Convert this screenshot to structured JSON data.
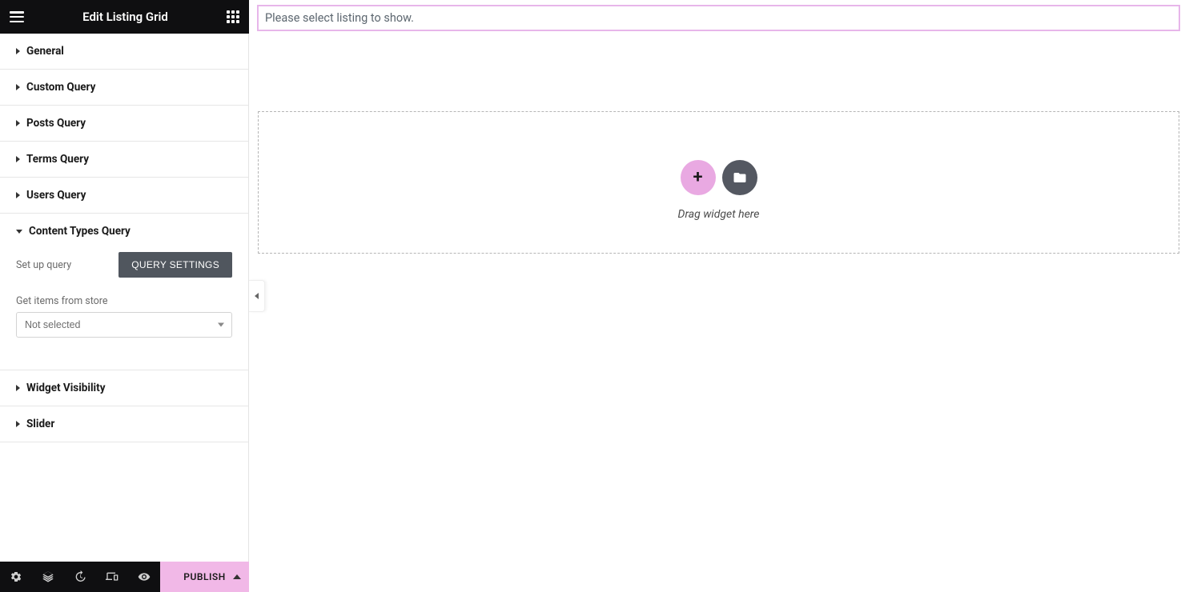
{
  "header": {
    "title": "Edit Listing Grid"
  },
  "sections": {
    "general": {
      "label": "General"
    },
    "custom_query": {
      "label": "Custom Query"
    },
    "posts_query": {
      "label": "Posts Query"
    },
    "terms_query": {
      "label": "Terms Query"
    },
    "users_query": {
      "label": "Users Query"
    },
    "content_types_query": {
      "label": "Content Types Query",
      "setup_label": "Set up query",
      "query_settings_btn": "QUERY SETTINGS",
      "store_label": "Get items from store",
      "store_value": "Not selected"
    },
    "widget_visibility": {
      "label": "Widget Visibility"
    },
    "slider": {
      "label": "Slider"
    }
  },
  "footer": {
    "publish": "PUBLISH"
  },
  "canvas": {
    "notice": "Please select listing to show.",
    "drag_hint": "Drag widget here"
  }
}
